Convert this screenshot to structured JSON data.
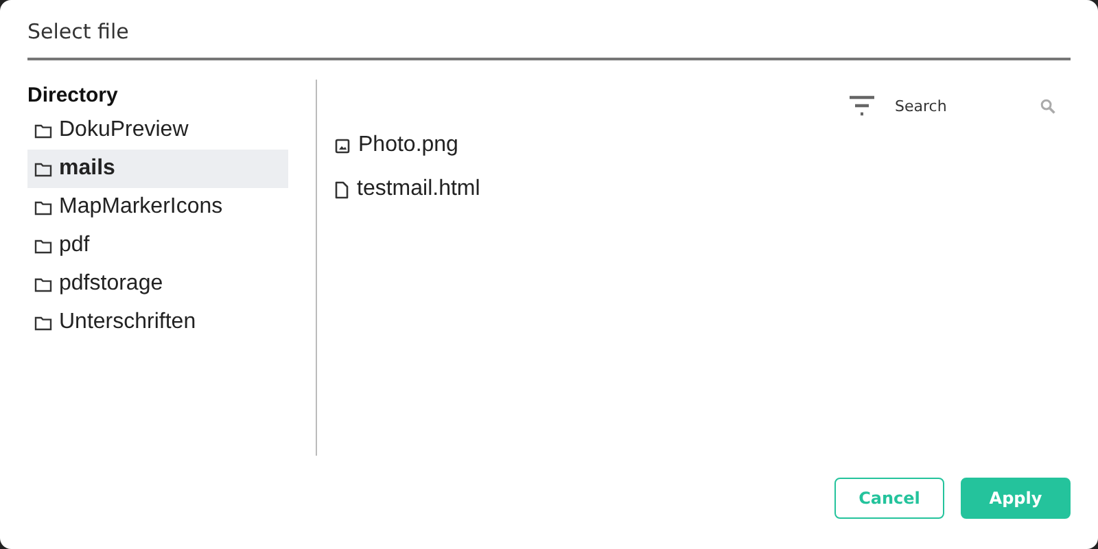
{
  "dialog": {
    "title": "Select file"
  },
  "directory": {
    "heading": "Directory",
    "items": [
      {
        "label": "DokuPreview",
        "selected": false
      },
      {
        "label": "mails",
        "selected": true
      },
      {
        "label": "MapMarkerIcons",
        "selected": false
      },
      {
        "label": "pdf",
        "selected": false
      },
      {
        "label": "pdfstorage",
        "selected": false
      },
      {
        "label": "Unterschriften",
        "selected": false
      }
    ]
  },
  "search": {
    "placeholder": "Search"
  },
  "files": [
    {
      "name": "Photo.png",
      "kind": "image"
    },
    {
      "name": "testmail.html",
      "kind": "file"
    }
  ],
  "buttons": [
    {
      "label": "Cancel",
      "kind": "outline"
    },
    {
      "label": "Apply",
      "kind": "primary"
    }
  ]
}
